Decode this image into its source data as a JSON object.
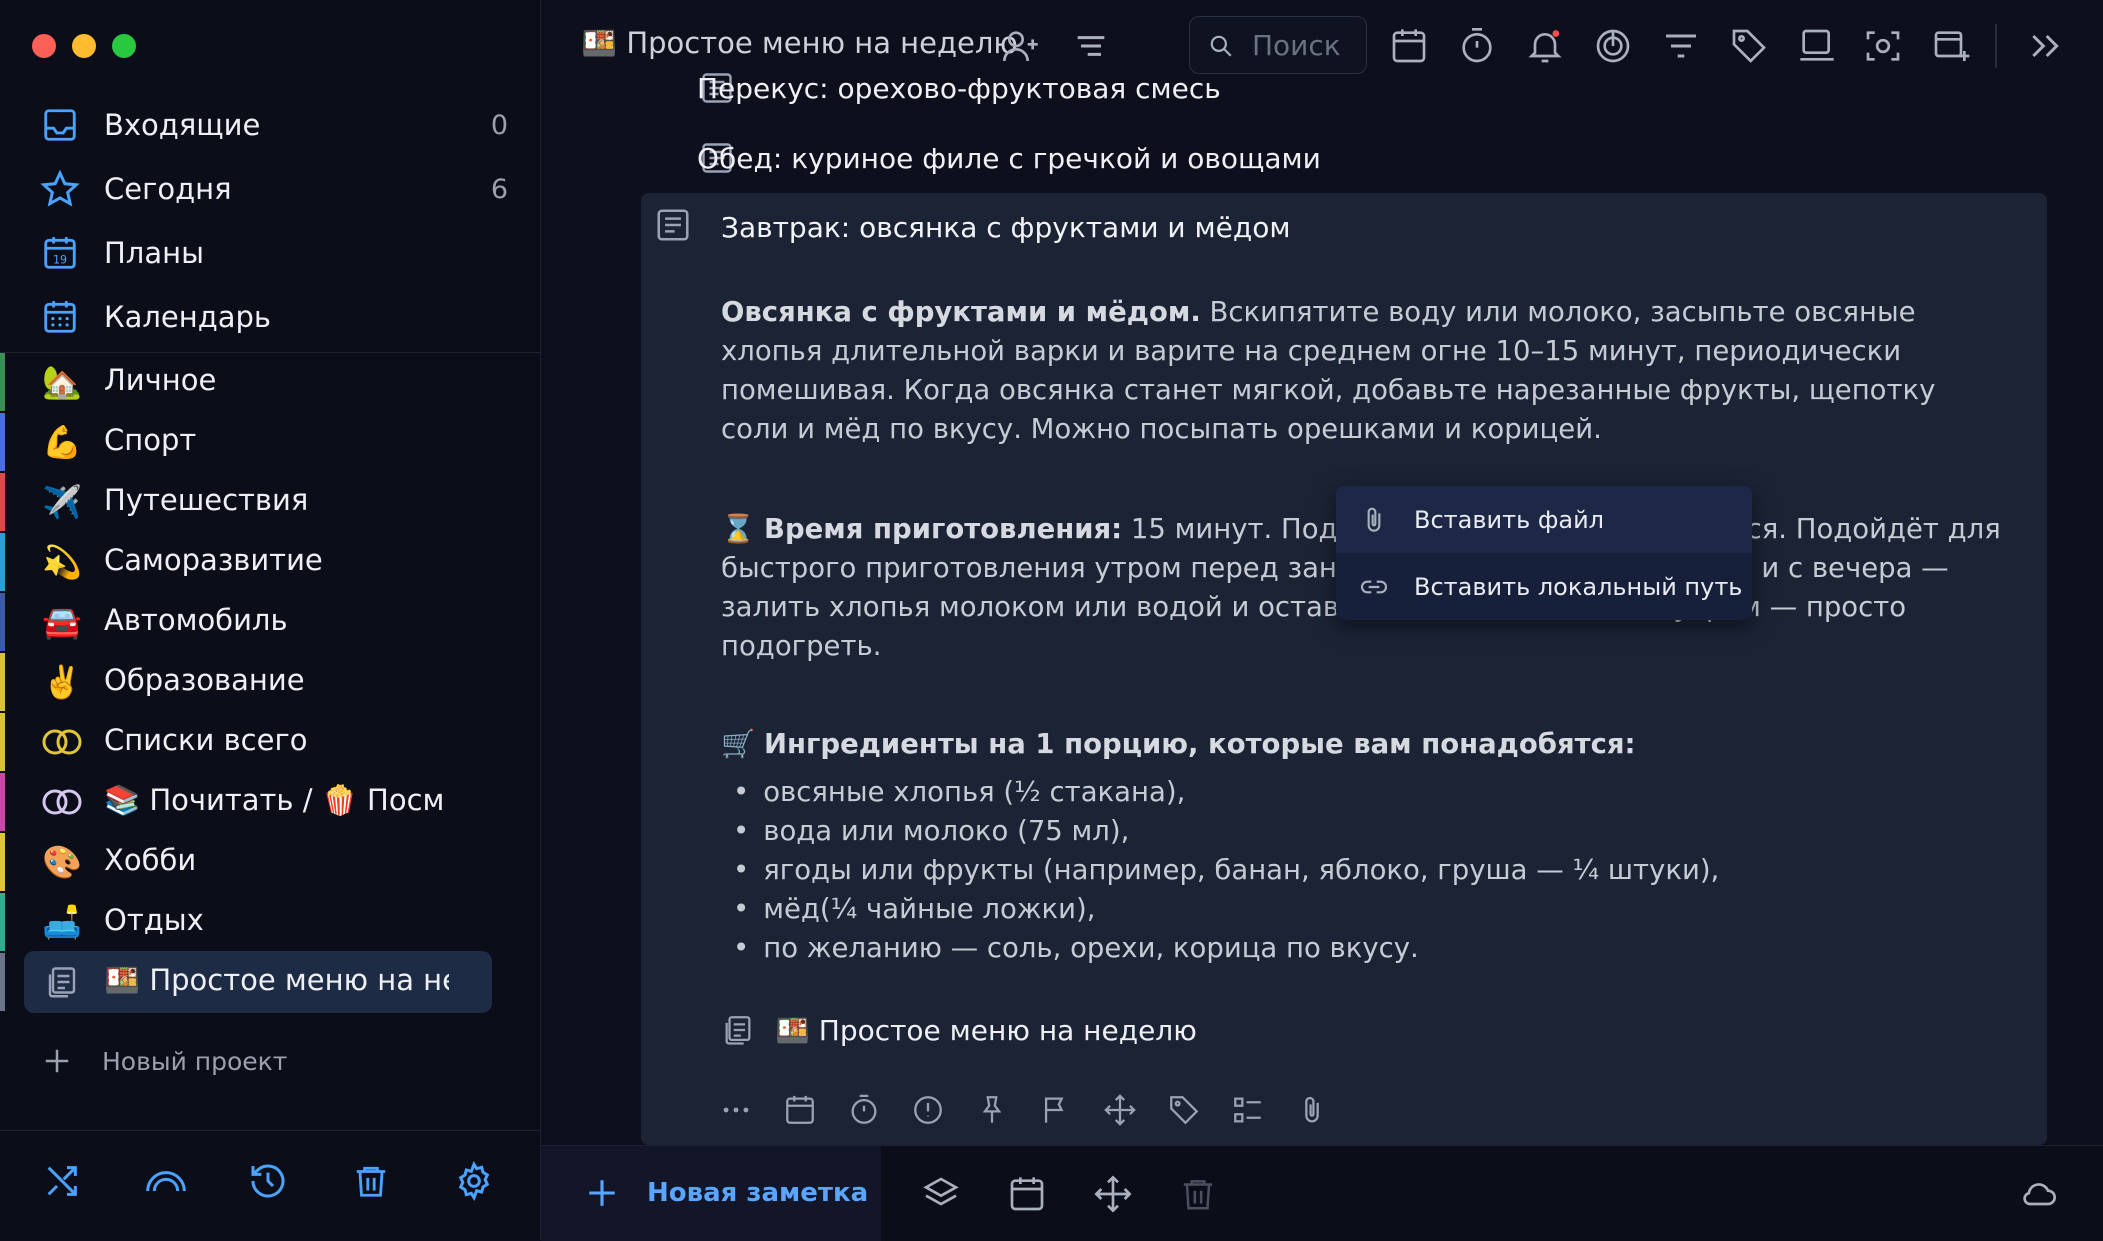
{
  "colors": {
    "accent": "#5aa6ff",
    "inbox_icon": "#4aa3ff",
    "traffic_red": "#fe5f57",
    "traffic_yellow": "#febc2e",
    "traffic_green": "#28c840",
    "notification_dot": "#ff4d4d"
  },
  "sidebar": {
    "nav": [
      {
        "label": "Входящие",
        "count": "0",
        "icon": "inbox-icon"
      },
      {
        "label": "Сегодня",
        "count": "6",
        "icon": "star-icon"
      },
      {
        "label": "Планы",
        "count": "",
        "icon": "calendar-19-icon"
      },
      {
        "label": "Календарь",
        "count": "",
        "icon": "calendar-grid-icon"
      }
    ],
    "projects": [
      {
        "emoji": "🏡",
        "label": "Личное",
        "color": "#3a8f55"
      },
      {
        "emoji": "💪",
        "label": "Спорт",
        "color": "#4b6fd6"
      },
      {
        "emoji": "✈️",
        "label": "Путешествия",
        "color": "#d94a4a"
      },
      {
        "emoji": "💫",
        "label": "Саморазвитие",
        "color": "#2e9fd6"
      },
      {
        "emoji": "🚘",
        "label": "Автомобиль",
        "color": "#3b5ba8"
      },
      {
        "emoji": "✌️",
        "label": "Образование",
        "color": "#d9c23a"
      },
      {
        "emoji": "◯",
        "label": "Списки всего",
        "color": "#d9c23a"
      },
      {
        "emoji": "◯",
        "label": "📚 Почитать / 🍿 Посмотреть",
        "color": "#c24aa8"
      },
      {
        "emoji": "🎨",
        "label": "Хобби",
        "color": "#e0c53a"
      },
      {
        "emoji": "🛋️",
        "label": "Отдых",
        "color": "#3aa88f"
      },
      {
        "emoji": "📋",
        "label": "🍱 Простое меню на неделю",
        "color": "#6b7488"
      }
    ],
    "new_project": "Новый проект"
  },
  "topbar": {
    "title": "🍱 Простое меню на неделю",
    "search_placeholder": "Поиск"
  },
  "main": {
    "rows": [
      {
        "label": "Перекус: орехово-фруктовая смесь"
      },
      {
        "label": "Обед: куриное филе с гречкой и овощами"
      }
    ],
    "card": {
      "title": "Завтрак: овсянка с фруктами и мёдом",
      "p1_bold": "Овсянка с фруктами и мёдом.",
      "p1_text": " Вскипятите воду или молоко, засыпьте овсяные хлопья длительной варки и варите на среднем огне 10–15 минут, периодически помешивая. Когда овсянка станет мягкой, добавьте нарезанные фрукты, щепотку соли и мёд по вкусу. Можно посыпать орешками и корицей.",
      "p2_emoji": "⌛",
      "p2_bold": "Время приготовления:",
      "p2_text": " 15 минут. Подготовка заранее не требуется. Подойдёт для быстрого приготовления утром перед занятиями. Можно приготовить и с вечера — залить хлопья молоком или водой и оставить в холодильнике, а утром — просто подогреть.",
      "p3_emoji": "🛒",
      "p3_bold": "Ингредиенты на 1 порцию, которые вам понадобятся:",
      "ingredients": [
        "овсяные хлопья (½ стакана),",
        "вода или молоко (75 мл),",
        "ягоды или фрукты (например, банан, яблоко, груша — ¼ штуки),",
        "мёд(¼ чайные ложки),",
        "по желанию — соль, орехи, корица по вкусу."
      ],
      "project_link": "🍱 Простое меню на неделю"
    }
  },
  "popup": {
    "items": [
      {
        "label": "Вставить файл",
        "icon": "paperclip-icon"
      },
      {
        "label": "Вставить локальный путь",
        "icon": "link-icon"
      }
    ]
  },
  "bottombar": {
    "new_note": "Новая заметка"
  }
}
